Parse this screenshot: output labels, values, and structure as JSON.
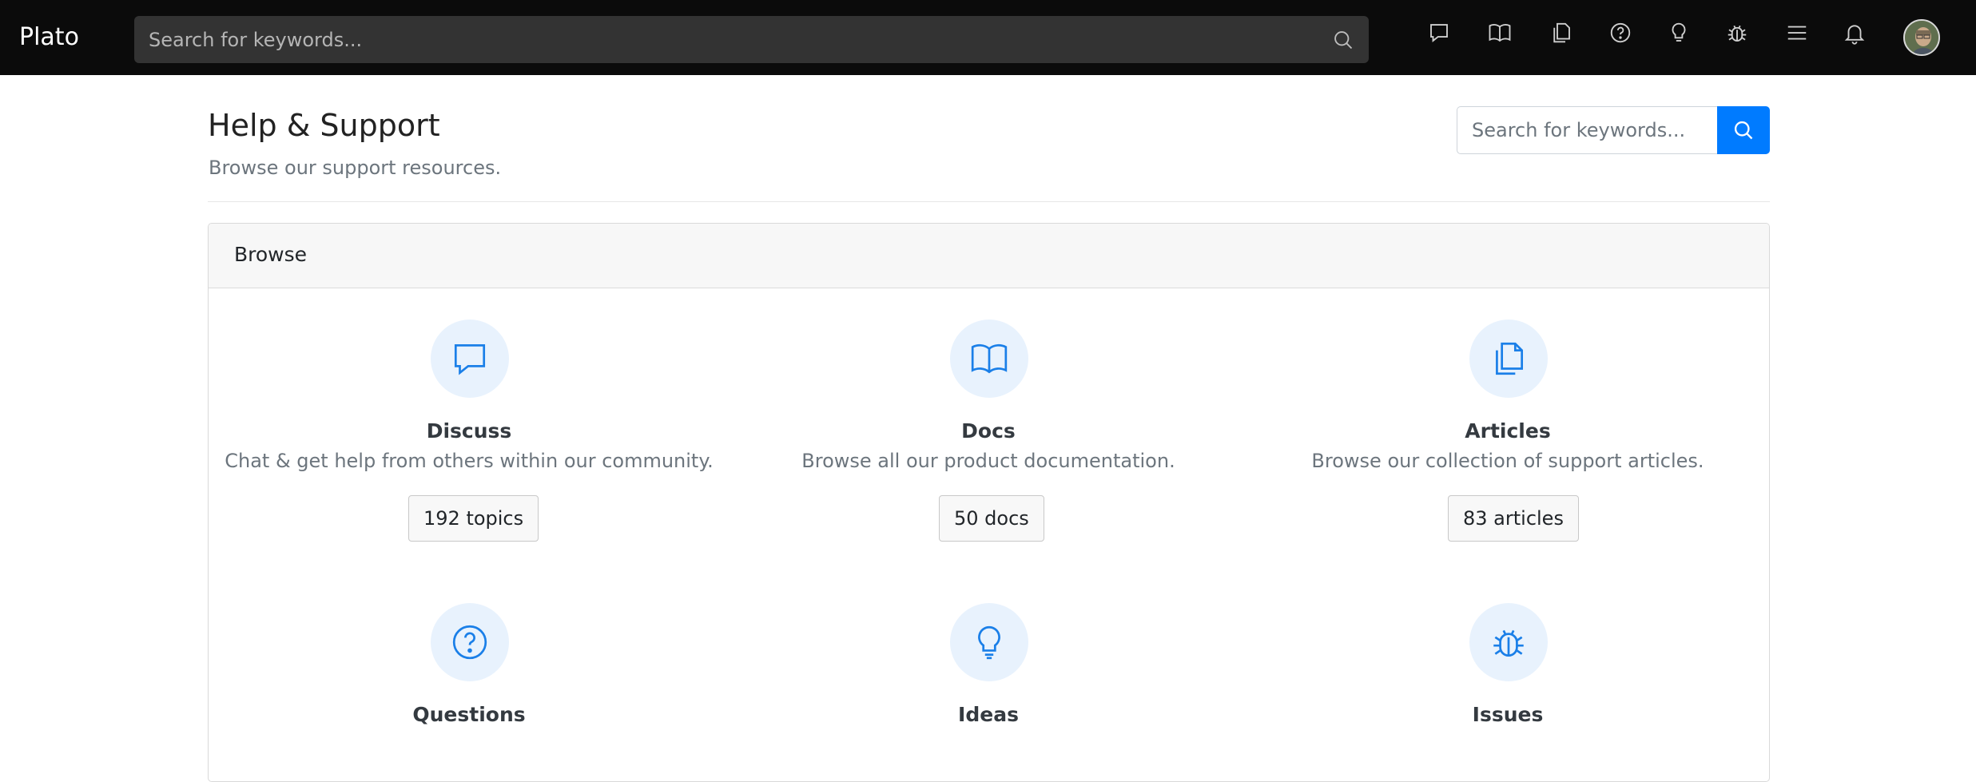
{
  "navbar": {
    "brand": "Plato",
    "search_placeholder": "Search for keywords...",
    "icons": [
      "chat-icon",
      "book-icon",
      "articles-icon",
      "question-icon",
      "lightbulb-icon",
      "bug-icon",
      "list-icon",
      "bell-icon"
    ]
  },
  "header": {
    "title": "Help & Support",
    "subtitle": "Browse our support resources.",
    "search_placeholder": "Search for keywords..."
  },
  "card": {
    "header": "Browse",
    "tiles": [
      {
        "title": "Discuss",
        "description": "Chat & get help from others within our community.",
        "count": "192 topics",
        "icon": "chat-icon"
      },
      {
        "title": "Docs",
        "description": "Browse all our product documentation.",
        "count": "50 docs",
        "icon": "book-icon"
      },
      {
        "title": "Articles",
        "description": "Browse our collection of support articles.",
        "count": "83 articles",
        "icon": "articles-icon"
      },
      {
        "title": "Questions",
        "icon": "question-icon"
      },
      {
        "title": "Ideas",
        "icon": "lightbulb-icon"
      },
      {
        "title": "Issues",
        "icon": "bug-icon"
      }
    ]
  },
  "colors": {
    "navbar_bg": "#0b0b0b",
    "accent": "#007bff",
    "icon_circle_bg": "#e8f2fd"
  }
}
